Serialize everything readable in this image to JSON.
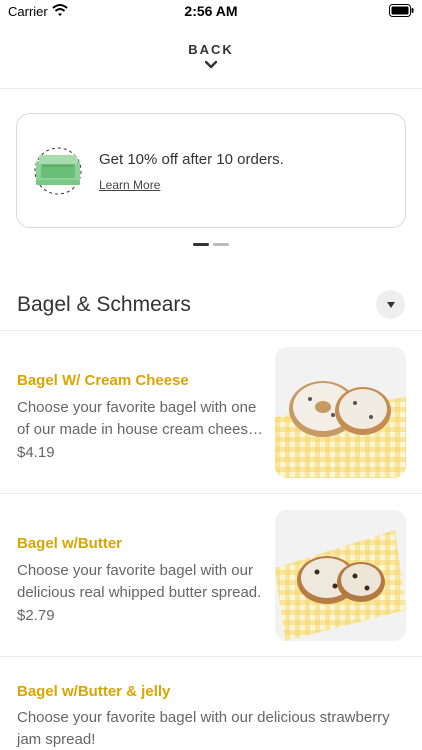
{
  "status_bar": {
    "carrier": "Carrier",
    "time": "2:56 AM"
  },
  "header": {
    "back_label": "BACK"
  },
  "promo": {
    "text": "Get 10% off after 10 orders.",
    "link": "Learn More"
  },
  "section": {
    "title": "Bagel & Schmears"
  },
  "items": [
    {
      "name": "Bagel W/ Cream Cheese",
      "description": "Choose your favorite bagel with one of our made in house cream cheese spreads.",
      "price": "$4.19"
    },
    {
      "name": "Bagel w/Butter",
      "description": "Choose your favorite bagel with our delicious real whipped butter spread.",
      "price": "$2.79"
    },
    {
      "name": "Bagel w/Butter & jelly",
      "description": "Choose your favorite bagel with our delicious strawberry jam spread!"
    }
  ],
  "colors": {
    "accent": "#d9a600",
    "text": "#333333",
    "muted": "#666666"
  }
}
